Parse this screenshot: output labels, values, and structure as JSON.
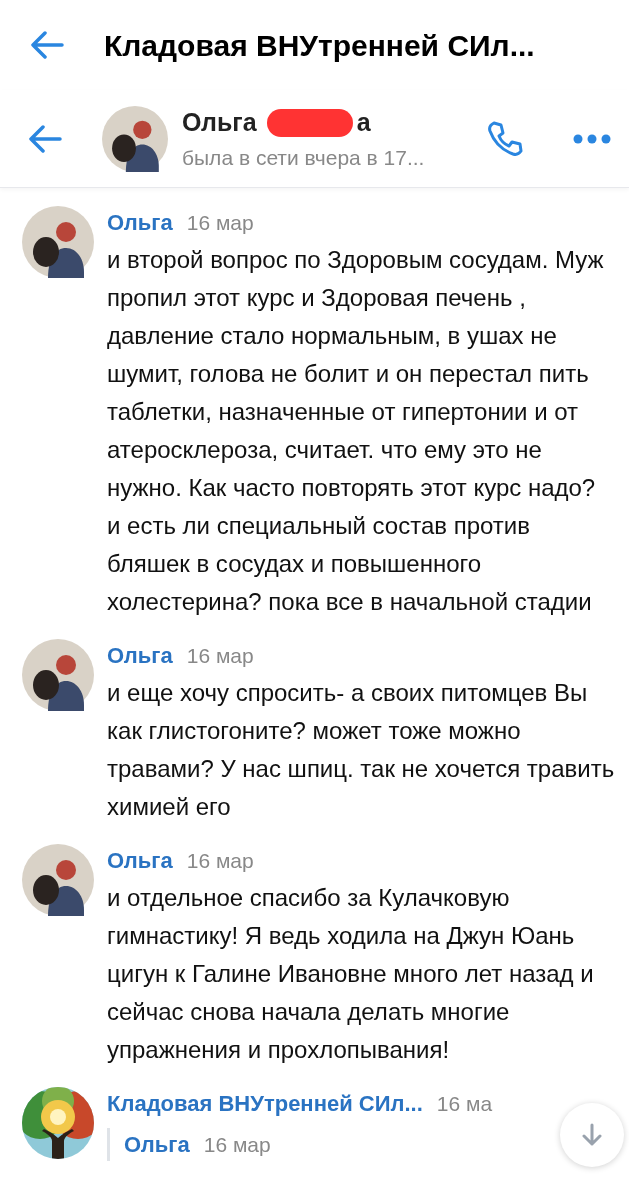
{
  "app_bar": {
    "title": "Кладовая ВНУтренней СИл..."
  },
  "chat_header": {
    "name_start": "Ольга",
    "name_end": "а",
    "redacted": true,
    "status": "была в сети вчера в 17..."
  },
  "messages": [
    {
      "kind": "message",
      "author": "Ольга",
      "time": "16 мар",
      "text": "и второй вопрос по Здоровым сосудам. Муж пропил этот курс и Здоровая печень , давление стало нормальным, в ушах не шумит, голова не болит и он перестал пить таблетки, назначенные от гипертонии и от атеросклероза, считает. что ему это не нужно. Как часто повторять этот курс надо? и есть ли специальный состав против бляшек в сосудах и повышенного холестерина? пока все в начальной стадии"
    },
    {
      "kind": "message",
      "author": "Ольга",
      "time": "16 мар",
      "text": "и еще хочу спросить- а своих питомцев Вы как глистогоните? может тоже можно травами? У нас шпиц. так не хочется травить химией его"
    },
    {
      "kind": "message",
      "author": "Ольга",
      "time": "16 мар",
      "text": "и отдельное спасибо за Кулачковую гимнастику! Я ведь ходила на Джун Юань цигун к Галине Ивановне много лет назад и сейчас снова начала делать многие упражнения и прохлопывания!"
    },
    {
      "kind": "group",
      "author": "Кладовая ВНУтренней СИл...",
      "time": "16 ма",
      "reply": {
        "author": "Ольга",
        "time": "16 мар"
      }
    }
  ]
}
